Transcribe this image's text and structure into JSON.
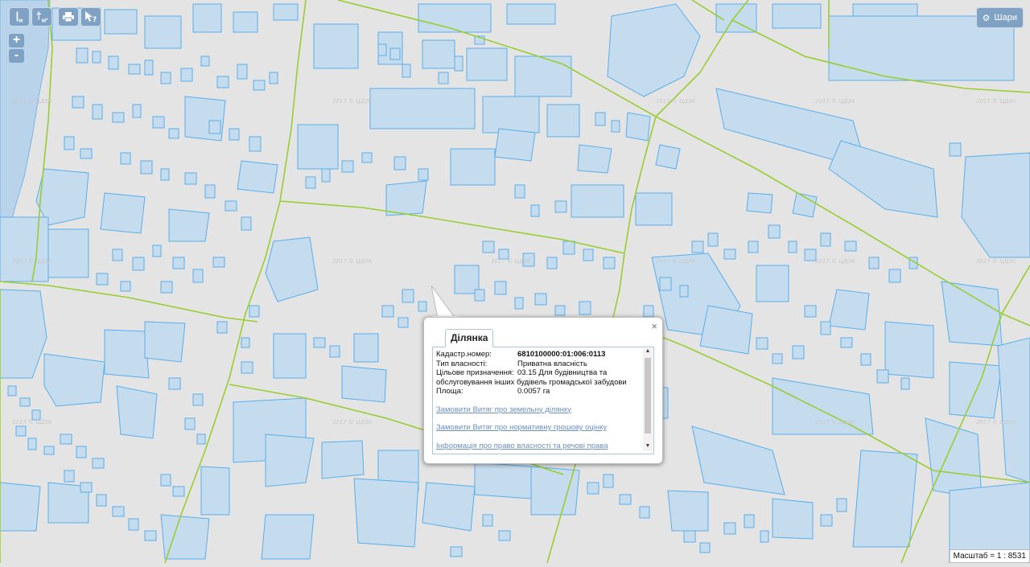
{
  "toolbar": {
    "ruler_icon": "ruler-icon",
    "area_icon": "area-measure-icon",
    "print_icon": "print-icon",
    "identify_icon": "identify-cursor-icon"
  },
  "zoom": {
    "in_label": "+",
    "out_label": "-"
  },
  "layers_button": {
    "label": "Шари",
    "icon": "gear-icon"
  },
  "watermark_text": "2017 © ЦДЗК",
  "popup": {
    "tab_label": "Ділянка",
    "close_label": "×",
    "fields": {
      "cadastral_label": "Кадастр.номер:",
      "cadastral_value": "6810100000:01:006:0113",
      "ownership_label": "Тип власності:",
      "ownership_value": "Приватна власність",
      "purpose_label": "Цільове призначення:",
      "purpose_value": "03.15 Для будівництва та",
      "purpose_continuation": "обслуговування інших будівель громадської забудови",
      "area_label": "Площа:",
      "area_value": "0.0057 га"
    },
    "links": [
      "Замовити Витяг про земельну ділянку",
      "Замовити Витяг про нормативну грошову оцінку",
      "Інформація про право власності та речові права"
    ]
  },
  "scale": {
    "label": "Масштаб = 1 : 8531"
  },
  "colors": {
    "parcel_fill": "#c5dcee",
    "parcel_stroke": "#5aaeea",
    "road": "#9acd32",
    "button": "#7fa2c4",
    "background": "#e4e4e4"
  }
}
